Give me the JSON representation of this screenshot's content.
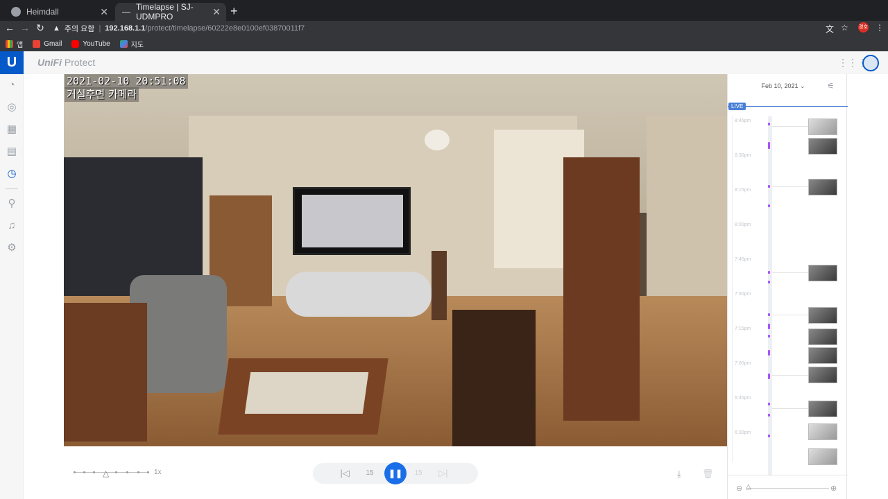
{
  "browser": {
    "tabs": [
      {
        "title": "Heimdall",
        "active": false
      },
      {
        "title": "Timelapse | SJ-UDMPRO",
        "active": true
      }
    ],
    "new_tab": "+",
    "security_label": "주의 요함",
    "url_host": "192.168.1.1",
    "url_path": "/protect/timelapse/60222e8e0100ef03870011f7",
    "profile_initials": "경호",
    "bookmarks": [
      {
        "label": "앱",
        "icon": "apps-grid-icon"
      },
      {
        "label": "Gmail",
        "icon": "gmail-icon"
      },
      {
        "label": "YouTube",
        "icon": "youtube-icon"
      },
      {
        "label": "지도",
        "icon": "maps-icon"
      }
    ]
  },
  "app": {
    "brand_prefix": "UniFi",
    "brand_name": "Protect",
    "logo_letter": "U",
    "accent_color": "#0559c9"
  },
  "sidebar": {
    "items": [
      {
        "name": "dashboard-icon",
        "active": false
      },
      {
        "name": "devices-icon",
        "active": false
      },
      {
        "name": "liveview-icon",
        "active": false
      },
      {
        "name": "recordings-icon",
        "active": false
      },
      {
        "name": "timelapse-icon",
        "active": true
      },
      {
        "name": "integrations-icon",
        "active": false
      },
      {
        "name": "alerts-icon",
        "active": false
      },
      {
        "name": "settings-icon",
        "active": false
      }
    ]
  },
  "video": {
    "timestamp": "2021-02-10 20:51:08",
    "camera_name": "거실후면 카메라"
  },
  "controls": {
    "speed_label": "1x",
    "state": "playing",
    "rewind_label": "15",
    "forward_label": "15"
  },
  "timeline": {
    "date": "Feb 10, 2021",
    "live_label": "LIVE",
    "hours": [
      "8:45pm",
      "8:30pm",
      "8:15pm",
      "8:00pm",
      "7:45pm",
      "7:30pm",
      "7:15pm",
      "7:00pm",
      "6:45pm",
      "6:30pm"
    ]
  }
}
